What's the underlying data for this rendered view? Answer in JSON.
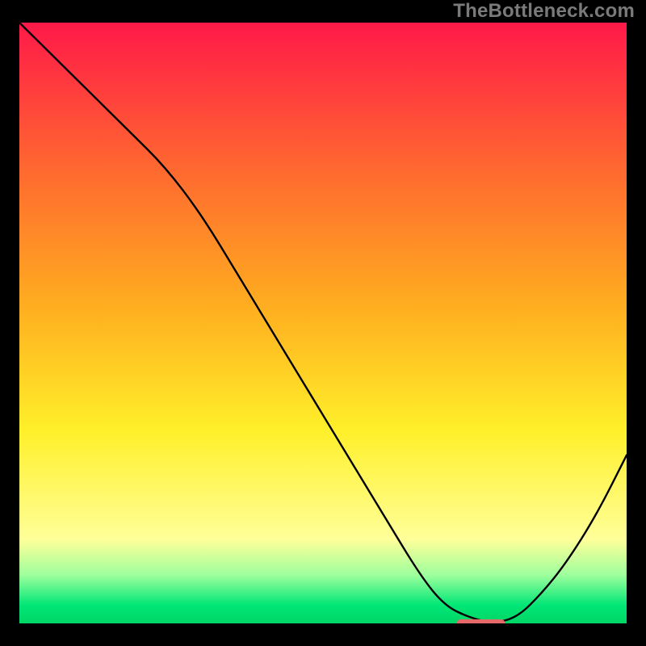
{
  "watermark": "TheBottleneck.com",
  "chart_data": {
    "type": "line",
    "title": "",
    "xlabel": "",
    "ylabel": "",
    "xlim": [
      0,
      100
    ],
    "ylim": [
      0,
      100
    ],
    "background_gradient": {
      "direction": "vertical",
      "stops": [
        {
          "offset": 0.0,
          "color": "#ff1949"
        },
        {
          "offset": 0.25,
          "color": "#ff6a2f"
        },
        {
          "offset": 0.48,
          "color": "#ffb01f"
        },
        {
          "offset": 0.68,
          "color": "#fff02a"
        },
        {
          "offset": 0.86,
          "color": "#ffff99"
        },
        {
          "offset": 0.92,
          "color": "#9cff9c"
        },
        {
          "offset": 0.97,
          "color": "#00e676"
        },
        {
          "offset": 1.0,
          "color": "#00d666"
        }
      ]
    },
    "series": [
      {
        "name": "bottleneck-curve",
        "color": "#000000",
        "stroke_width": 2.4,
        "x": [
          0,
          6,
          12,
          18,
          24,
          30,
          36,
          42,
          48,
          54,
          60,
          66,
          70,
          74,
          78,
          82,
          86,
          90,
          95,
          100
        ],
        "y": [
          100,
          94,
          88,
          82,
          76,
          68,
          58,
          48,
          38,
          28,
          18,
          8,
          3,
          1,
          0,
          1,
          5,
          10,
          18,
          28
        ]
      }
    ],
    "marker": {
      "name": "sweet-spot-marker",
      "color": "#e46a6a",
      "x_center": 76,
      "width": 8,
      "y": 0,
      "thickness_px": 10,
      "radius_px": 5
    },
    "grid": false,
    "legend": false
  }
}
